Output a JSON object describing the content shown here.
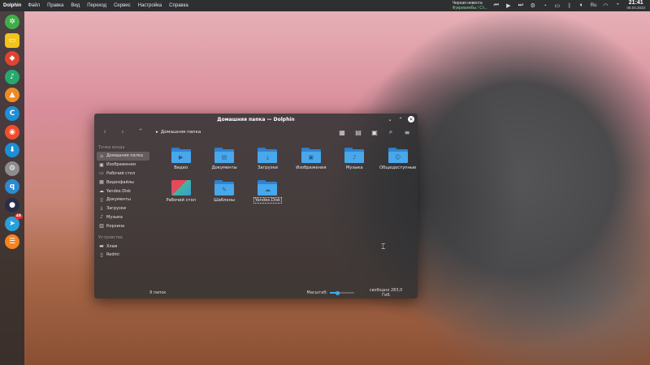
{
  "topbar": {
    "app_name": "Dolphin",
    "menu": [
      "Файл",
      "Правка",
      "Вид",
      "Переход",
      "Сервис",
      "Настройка",
      "Справка"
    ],
    "news_line1": "Черная невеста",
    "news_line2": "Фукрианмбы / Ст...",
    "layout": "Ru",
    "time": "21:41",
    "date": "06.04.2023"
  },
  "dock": {
    "badge": "48"
  },
  "window": {
    "title": "Домашняя папка — Dolphin",
    "breadcrumb": "Домашняя папка",
    "sidebar": {
      "places_heading": "Точки входа",
      "places": [
        {
          "label": "Домашняя папка",
          "icon": "home-icon"
        },
        {
          "label": "Изображения",
          "icon": "image-icon"
        },
        {
          "label": "Рабочий стол",
          "icon": "desktop-icon"
        },
        {
          "label": "Видеофайлы",
          "icon": "video-icon"
        },
        {
          "label": "Yandex.Disk",
          "icon": "cloud-icon"
        },
        {
          "label": "Документы",
          "icon": "document-icon"
        },
        {
          "label": "Загрузки",
          "icon": "download-icon"
        },
        {
          "label": "Музыка",
          "icon": "music-icon"
        },
        {
          "label": "Корзина",
          "icon": "trash-icon"
        }
      ],
      "devices_heading": "Устройства",
      "devices": [
        {
          "label": "Хлам",
          "icon": "drive-icon"
        },
        {
          "label": "Redmi",
          "icon": "phone-icon"
        }
      ]
    },
    "files": [
      {
        "label": "Видео",
        "icon": "video-folder-icon"
      },
      {
        "label": "Документы",
        "icon": "documents-folder-icon"
      },
      {
        "label": "Загрузки",
        "icon": "downloads-folder-icon"
      },
      {
        "label": "Изображения",
        "icon": "pictures-folder-icon"
      },
      {
        "label": "Музыка",
        "icon": "music-folder-icon"
      },
      {
        "label": "Общедоступные",
        "icon": "public-folder-icon"
      },
      {
        "label": "Рабочий стол",
        "icon": "desktop-folder-icon"
      },
      {
        "label": "Шаблоны",
        "icon": "templates-folder-icon"
      },
      {
        "label": "Yandex.Disk",
        "icon": "cloud-folder-icon"
      }
    ],
    "status": {
      "count": "9 папок",
      "zoom_label": "Масштаб:",
      "zoom_level": 0.3,
      "free": "свободно 283,0 ГиБ"
    }
  },
  "colors": {
    "accent": "#3daee9",
    "folder": "#4aa7ea"
  }
}
